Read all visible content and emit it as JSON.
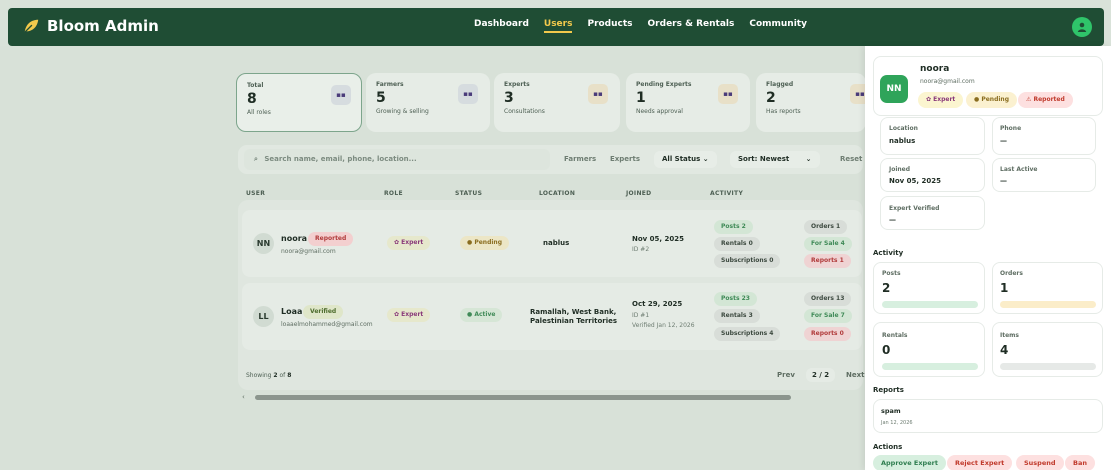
{
  "app": {
    "title": "Bloom Admin"
  },
  "nav": {
    "items": [
      "Dashboard",
      "Users",
      "Products",
      "Orders & Rentals",
      "Community"
    ],
    "active": "Users"
  },
  "stats": [
    {
      "label": "Total",
      "value": "8",
      "sub": "All roles"
    },
    {
      "label": "Farmers",
      "value": "5",
      "sub": "Growing & selling"
    },
    {
      "label": "Experts",
      "value": "3",
      "sub": "Consultations"
    },
    {
      "label": "Pending Experts",
      "value": "1",
      "sub": "Needs approval"
    },
    {
      "label": "Flagged",
      "value": "2",
      "sub": "Has reports"
    }
  ],
  "toolbar": {
    "search_placeholder": "Search name, email, phone, location...",
    "search_icon_glyph": "⌕",
    "filter_farmers": "Farmers",
    "filter_experts": "Experts",
    "status_select": "All Status",
    "sort_select": "Sort: Newest",
    "reset": "Reset"
  },
  "table": {
    "headers": [
      "USER",
      "ROLE",
      "STATUS",
      "LOCATION",
      "JOINED",
      "ACTIVITY"
    ],
    "rows": [
      {
        "initials": "NN",
        "name": "noora",
        "badge": "Reported",
        "email": "noora@gmail.com",
        "role": "Expert",
        "status": "Pending",
        "location_line1": "nablus",
        "location_line2": "",
        "joined": "Nov 05, 2025",
        "id": "ID #2",
        "verified": "",
        "activity": [
          "Posts 2",
          "Rentals 0",
          "Subscriptions 0",
          "Orders 1",
          "For Sale 4",
          "Reports 1"
        ]
      },
      {
        "initials": "LL",
        "name": "Loaa",
        "badge": "Verified",
        "email": "loaaelmohammed@gmail.com",
        "role": "Expert",
        "status": "Active",
        "location_line1": "Ramallah, West Bank,",
        "location_line2": "Palestinian Territories",
        "joined": "Oct 29, 2025",
        "id": "ID #1",
        "verified": "Verified Jan 12, 2026",
        "activity": [
          "Posts 23",
          "Rentals 3",
          "Subscriptions 4",
          "Orders 13",
          "For Sale 7",
          "Reports 0"
        ]
      }
    ]
  },
  "pagination": {
    "showing_prefix": "Showing",
    "showing_count": "2",
    "showing_of": "of",
    "showing_total": "8",
    "prev": "Prev",
    "page": "2 / 2",
    "next": "Next"
  },
  "panel": {
    "initials": "NN",
    "name": "noora",
    "email": "noora@gmail.com",
    "badges": {
      "expert": "Expert",
      "pending": "Pending",
      "reported": "Reported"
    },
    "fields": {
      "location_label": "Location",
      "location_value": "nablus",
      "phone_label": "Phone",
      "phone_value": "—",
      "joined_label": "Joined",
      "joined_value": "Nov 05, 2025",
      "last_active_label": "Last Active",
      "last_active_value": "—",
      "expert_verified_label": "Expert Verified",
      "expert_verified_value": "—"
    },
    "activity_title": "Activity",
    "activity": [
      {
        "label": "Posts",
        "value": "2",
        "bar_color": "#d7efdf"
      },
      {
        "label": "Orders",
        "value": "1",
        "bar_color": "#fbedc9"
      },
      {
        "label": "Rentals",
        "value": "0",
        "bar_color": "#d7efdf"
      },
      {
        "label": "Items",
        "value": "4",
        "bar_color": "#e6e9e7"
      }
    ],
    "reports_title": "Reports",
    "report": {
      "reason": "spam",
      "date": "Jan 12, 2026"
    },
    "actions_title": "Actions",
    "actions": [
      "Approve Expert",
      "Reject Expert",
      "Suspend",
      "Ban"
    ]
  },
  "colors": {
    "brand": "#1f4d34",
    "accent": "#f2c94c",
    "success": "#2fa45a",
    "danger": "#c0392b"
  }
}
